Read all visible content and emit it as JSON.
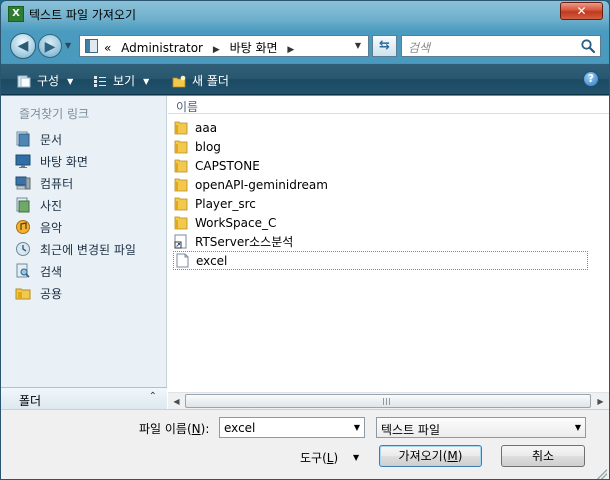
{
  "window": {
    "title": "텍스트 파일 가져오기",
    "app_icon_glyph": "X",
    "close_glyph": "✕"
  },
  "address_bar": {
    "overflow_glyph": "«",
    "crumbs": [
      "Administrator",
      "바탕 화면"
    ],
    "separator_glyph": "▶",
    "search_placeholder": "검색"
  },
  "toolbar": {
    "organize_label": "구성",
    "views_label": "보기",
    "new_folder_label": "새 폴더",
    "help_glyph": "?"
  },
  "sidebar": {
    "header": "즐겨찾기 링크",
    "items": [
      {
        "label": "문서",
        "icon": "documents-icon"
      },
      {
        "label": "바탕 화면",
        "icon": "desktop-icon"
      },
      {
        "label": "컴퓨터",
        "icon": "computer-icon"
      },
      {
        "label": "사진",
        "icon": "pictures-icon"
      },
      {
        "label": "음악",
        "icon": "music-icon"
      },
      {
        "label": "최근에 변경된 파일",
        "icon": "recent-icon"
      },
      {
        "label": "검색",
        "icon": "search-folder-icon"
      },
      {
        "label": "공용",
        "icon": "public-icon"
      }
    ],
    "folders_label": "폴더"
  },
  "file_list": {
    "column_name": "이름",
    "items": [
      {
        "name": "aaa",
        "type": "folder"
      },
      {
        "name": "blog",
        "type": "folder"
      },
      {
        "name": "CAPSTONE",
        "type": "folder"
      },
      {
        "name": "openAPI-geminidream",
        "type": "folder"
      },
      {
        "name": "Player_src",
        "type": "folder"
      },
      {
        "name": "WorkSpace_C",
        "type": "folder"
      },
      {
        "name": "RTServer소스분석",
        "type": "shortcut"
      },
      {
        "name": "excel",
        "type": "file",
        "selected": true
      }
    ]
  },
  "footer": {
    "filename_label_pre": "파일 이름(",
    "filename_label_key": "N",
    "filename_label_post": "):",
    "filename_value": "excel",
    "filetype_value": "텍스트 파일",
    "tools_label_pre": "도구(",
    "tools_label_key": "L",
    "tools_label_post": ")",
    "open_label_pre": "가져오기(",
    "open_label_key": "M",
    "open_label_post": ")",
    "cancel_label": "취소"
  },
  "colors": {
    "folder": "#e8b528",
    "toolbar": "#28566f",
    "close_button": "#c0391f"
  }
}
